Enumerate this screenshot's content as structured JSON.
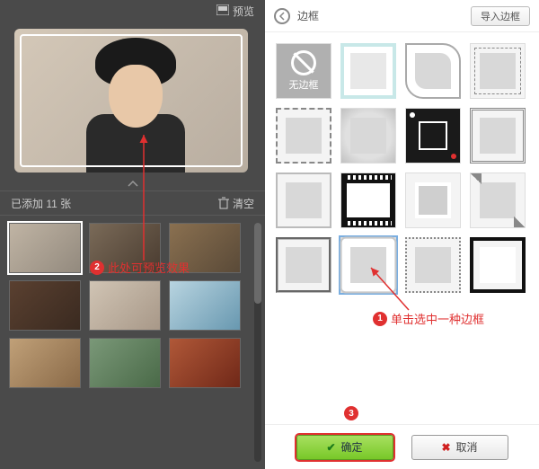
{
  "left": {
    "preview_label": "预览",
    "added_prefix": "已添加",
    "added_count": "11",
    "added_suffix": "张",
    "clear_label": "清空"
  },
  "right": {
    "title": "边框",
    "import_label": "导入边框",
    "noframe_label": "无边框",
    "ok_label": "确定",
    "cancel_label": "取消"
  },
  "annotations": {
    "step1_num": "1",
    "step1_text": "单击选中一种边框",
    "step2_num": "2",
    "step2_text": "此处可预览效果",
    "step3_num": "3"
  }
}
